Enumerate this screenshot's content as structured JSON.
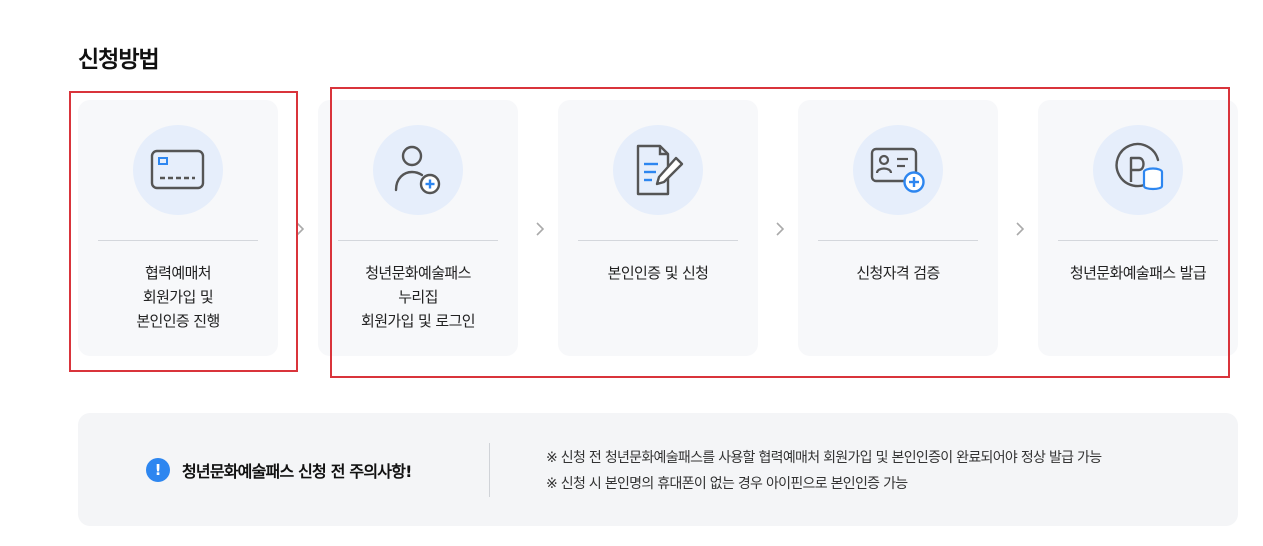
{
  "section": {
    "title": "신청방법"
  },
  "steps": [
    {
      "label": "협력예매처\n회원가입 및\n본인인증 진행",
      "icon": "credit-card-icon"
    },
    {
      "label": "청년문화예술패스\n누리집\n회원가입 및 로그인",
      "icon": "user-add-icon"
    },
    {
      "label": "본인인증 및 신청",
      "icon": "document-edit-icon"
    },
    {
      "label": "신청자격 검증",
      "icon": "id-card-add-icon"
    },
    {
      "label": "청년문화예술패스 발급",
      "icon": "points-coins-icon"
    }
  ],
  "notice": {
    "badge": "!",
    "title": "청년문화예술패스 신청 전 주의사항!",
    "items": [
      "※ 신청 전 청년문화예술패스를 사용할 협력예매처 회원가입 및 본인인증이 완료되어야 정상 발급 가능",
      "※ 신청 시 본인명의 휴대폰이 없는 경우 아이핀으로 본인인증 가능"
    ]
  },
  "colors": {
    "accent": "#2d86f0",
    "icon_stroke": "#555555",
    "highlight_border": "#d9343b",
    "card_bg": "#f7f8fa",
    "icon_circle_bg": "#e6eefb"
  }
}
